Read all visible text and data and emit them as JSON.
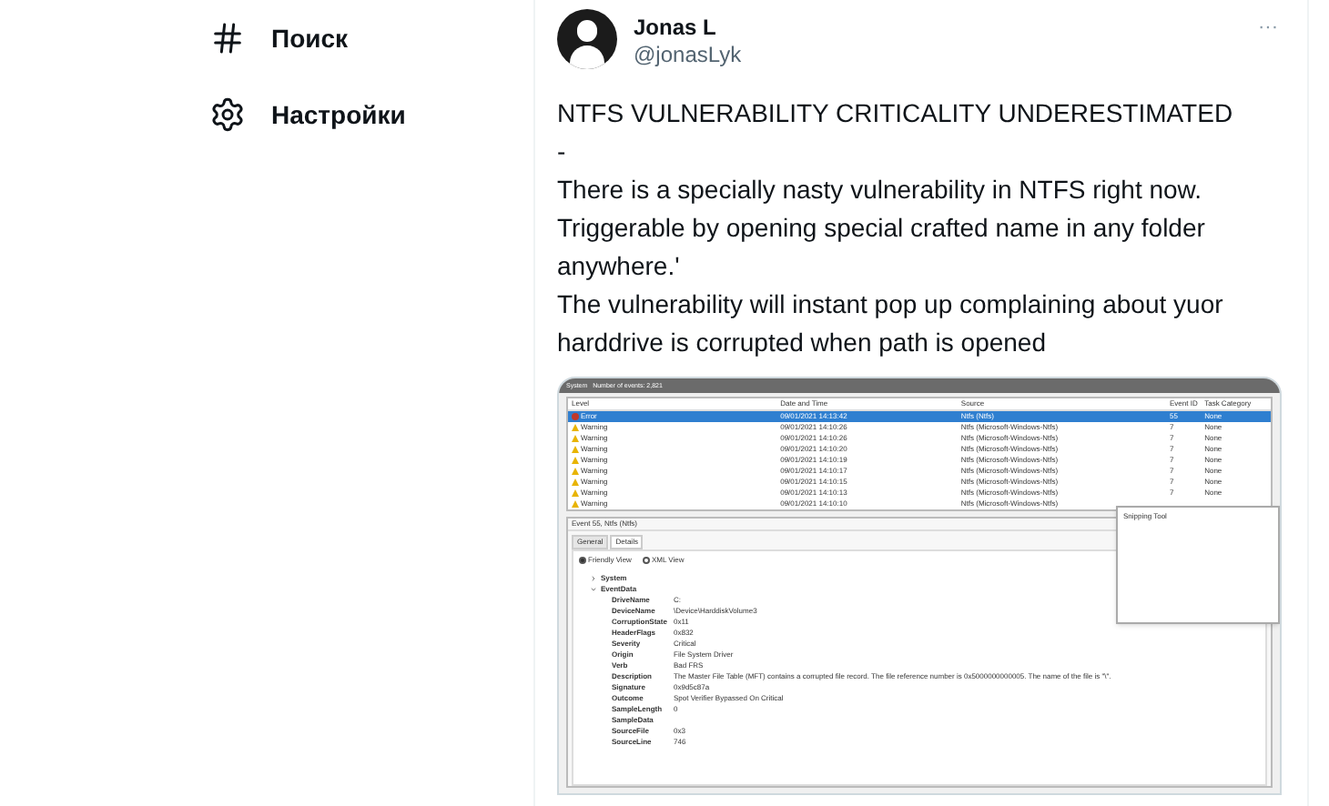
{
  "sidebar": {
    "items": [
      {
        "kind": "hash",
        "label": "Поиск"
      },
      {
        "kind": "gear",
        "label": "Настройки"
      }
    ]
  },
  "tweet": {
    "name": "Jonas L",
    "handle": "@jonasLyk",
    "more": "···",
    "paragraphs": [
      "NTFS VULNERABILITY CRITICALITY UNDERESTIMATED",
      "-",
      "There is a specially nasty vulnerability in NTFS right now.",
      "Triggerable by opening special crafted name in any folder anywhere.'",
      "The vulnerability will instant pop up complaining about yuor harddrive is corrupted when path is opened"
    ],
    "screenshot": {
      "title": "System   Number of events: 2,821",
      "columns": [
        "Level",
        "Date and Time",
        "Source",
        "Event ID",
        "Task Category"
      ],
      "rows": [
        {
          "kind": "error",
          "selected": true,
          "cells": [
            "Error",
            "09/01/2021 14:13:42",
            "Ntfs (Ntfs)",
            "55",
            "None"
          ]
        },
        {
          "kind": "warning",
          "selected": false,
          "cells": [
            "Warning",
            "09/01/2021 14:10:26",
            "Ntfs (Microsoft-Windows-Ntfs)",
            "7",
            "None"
          ]
        },
        {
          "kind": "warning",
          "selected": false,
          "cells": [
            "Warning",
            "09/01/2021 14:10:26",
            "Ntfs (Microsoft-Windows-Ntfs)",
            "7",
            "None"
          ]
        },
        {
          "kind": "warning",
          "selected": false,
          "cells": [
            "Warning",
            "09/01/2021 14:10:20",
            "Ntfs (Microsoft-Windows-Ntfs)",
            "7",
            "None"
          ]
        },
        {
          "kind": "warning",
          "selected": false,
          "cells": [
            "Warning",
            "09/01/2021 14:10:19",
            "Ntfs (Microsoft-Windows-Ntfs)",
            "7",
            "None"
          ]
        },
        {
          "kind": "warning",
          "selected": false,
          "cells": [
            "Warning",
            "09/01/2021 14:10:17",
            "Ntfs (Microsoft-Windows-Ntfs)",
            "7",
            "None"
          ]
        },
        {
          "kind": "warning",
          "selected": false,
          "cells": [
            "Warning",
            "09/01/2021 14:10:15",
            "Ntfs (Microsoft-Windows-Ntfs)",
            "7",
            "None"
          ]
        },
        {
          "kind": "warning",
          "selected": false,
          "cells": [
            "Warning",
            "09/01/2021 14:10:13",
            "Ntfs (Microsoft-Windows-Ntfs)",
            "7",
            "None"
          ]
        },
        {
          "kind": "warning",
          "selected": false,
          "cells": [
            "Warning",
            "09/01/2021 14:10:10",
            "Ntfs (Microsoft-Windows-Ntfs)"
          ]
        }
      ],
      "popup": "Snipping Tool",
      "event_title": "Event 55, Ntfs (Ntfs)",
      "tabs": [
        {
          "label": "General",
          "selected": false
        },
        {
          "label": "Details",
          "selected": true
        }
      ],
      "views": [
        {
          "label": "Friendly View",
          "selected": true
        },
        {
          "label": "XML View",
          "selected": false
        }
      ],
      "tree": [
        {
          "label": "System",
          "expanded": false
        },
        {
          "label": "EventData",
          "expanded": true
        }
      ],
      "fields": [
        [
          "DriveName",
          "C:"
        ],
        [
          "DeviceName",
          "\\Device\\HarddiskVolume3"
        ],
        [
          "CorruptionState",
          "0x11"
        ],
        [
          "HeaderFlags",
          "0x832"
        ],
        [
          "Severity",
          "Critical"
        ],
        [
          "Origin",
          "File System Driver"
        ],
        [
          "Verb",
          "Bad FRS"
        ],
        [
          "Description",
          "The Master File Table (MFT) contains a corrupted file record. The file reference number is 0x5000000000005. The name of the file is \"\\\"."
        ],
        [
          "Signature",
          "0x9d5c87a"
        ],
        [
          "Outcome",
          "Spot Verifier Bypassed On Critical"
        ],
        [
          "SampleLength",
          "0"
        ],
        [
          "SampleData"
        ],
        [
          "SourceFile",
          "0x3"
        ],
        [
          "SourceLine",
          "746"
        ]
      ]
    }
  }
}
